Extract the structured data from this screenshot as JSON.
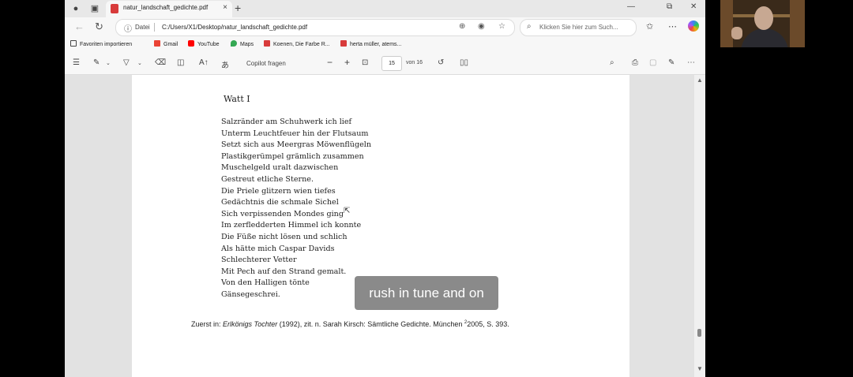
{
  "tab": {
    "title": "natur_landschaft_gedichte.pdf",
    "close": "×",
    "new": "+"
  },
  "window": {
    "min": "—",
    "max": "⧉",
    "close": "✕"
  },
  "address": {
    "scheme_label": "Datei",
    "url": "C:/Users/X1/Desktop/natur_landschaft_gedichte.pdf"
  },
  "search": {
    "placeholder": "Klicken Sie hier zum Such..."
  },
  "favorites": [
    {
      "label": "Favoriten importieren",
      "color": "#444444"
    },
    {
      "label": "Gmail",
      "color": "#ea4335"
    },
    {
      "label": "YouTube",
      "color": "#ff0000"
    },
    {
      "label": "Maps",
      "color": "#34a853"
    },
    {
      "label": "Koenen, Die Farbe R...",
      "color": "#d83b3b"
    },
    {
      "label": "herta müller, atems...",
      "color": "#d83b3b"
    }
  ],
  "pdf_toolbar": {
    "copilot": "Copilot fragen",
    "zoom_out": "−",
    "zoom_in": "+",
    "page_current": "15",
    "page_total": "von 16"
  },
  "document": {
    "title": "Watt I",
    "poem": [
      "Salzränder am Schuhwerk ich lief",
      "Unterm Leuchtfeuer hin der Flutsaum",
      "Setzt sich aus Meergras Möwenflügeln",
      "Plastikgerümpel grämlich zusammen",
      "Muschelgeld uralt dazwischen",
      "Gestreut etliche Sterne.",
      "Die Priele glitzern wien tiefes",
      "Gedächtnis die schmale Sichel",
      "Sich verpissenden Mondes ging",
      "Im zerfledderten Himmel ich konnte",
      "Die Füße nicht lösen und schlich",
      "Als hätte mich Caspar Davids",
      "Schlechterer Vetter",
      "Mit Pech auf den Strand gemalt.",
      "Von den Halligen tönte",
      "Gänsegeschrei."
    ],
    "source_prefix": "Zuerst in: ",
    "source_work": "Erlkönigs Tochter",
    "source_rest": " (1992), zit. n. Sarah Kirsch: Sämtliche Gedichte. München ",
    "source_edition": "2",
    "source_end": "2005, S. 393."
  },
  "caption": "rush in tune and on"
}
